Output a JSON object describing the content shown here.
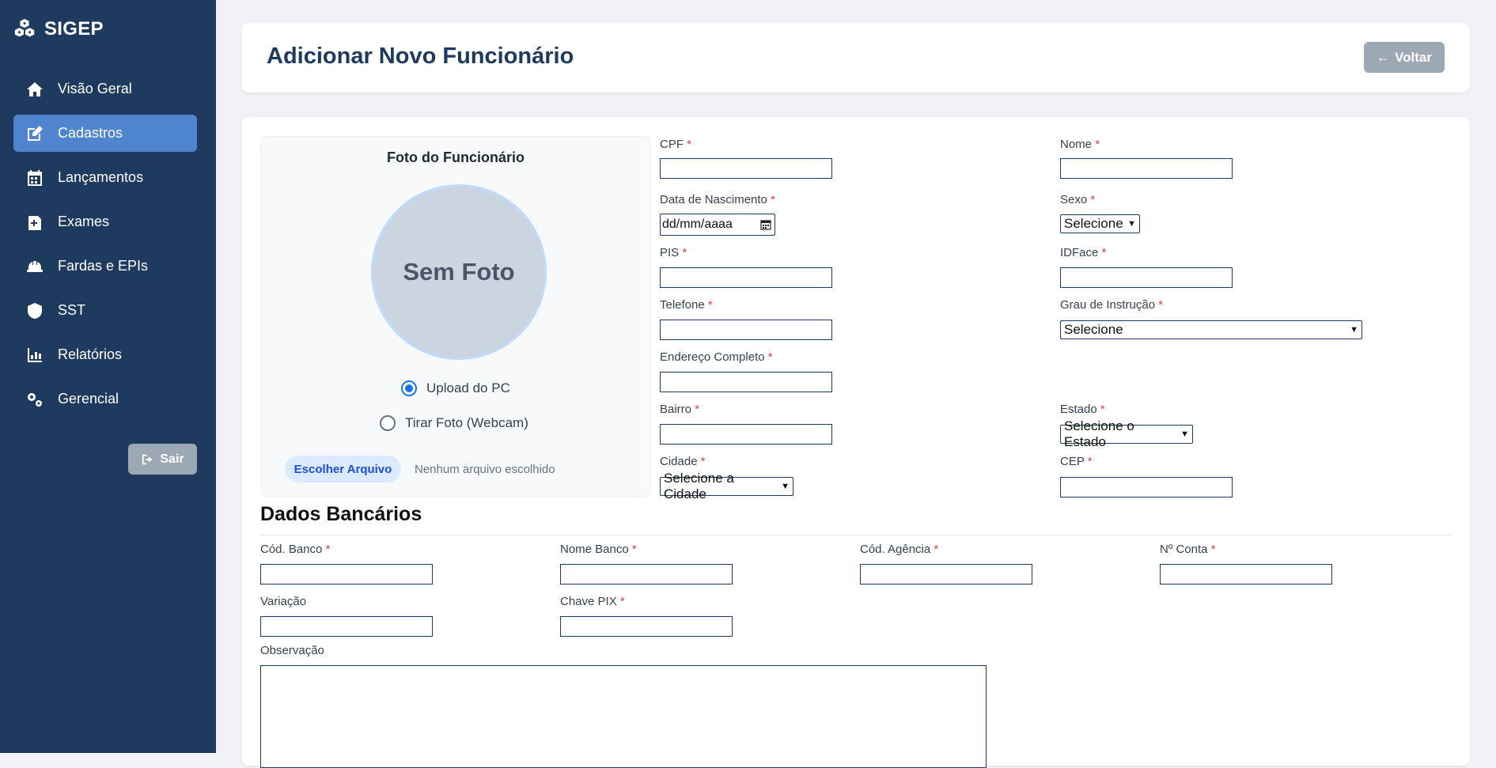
{
  "brand": {
    "name": "SIGEP"
  },
  "sidebar": {
    "items": [
      {
        "label": "Visão Geral",
        "icon": "home-icon",
        "active": false
      },
      {
        "label": "Cadastros",
        "icon": "edit-icon",
        "active": true
      },
      {
        "label": "Lançamentos",
        "icon": "calendar-icon",
        "active": false
      },
      {
        "label": "Exames",
        "icon": "medical-file-icon",
        "active": false
      },
      {
        "label": "Fardas e EPIs",
        "icon": "hard-hat-icon",
        "active": false
      },
      {
        "label": "SST",
        "icon": "shield-icon",
        "active": false
      },
      {
        "label": "Relatórios",
        "icon": "chart-icon",
        "active": false
      },
      {
        "label": "Gerencial",
        "icon": "gears-icon",
        "active": false
      }
    ],
    "logout_label": "Sair"
  },
  "header": {
    "title": "Adicionar Novo Funcionário",
    "back_label": "Voltar"
  },
  "photo": {
    "title": "Foto do Funcionário",
    "placeholder": "Sem Foto",
    "option_upload": "Upload do PC",
    "option_webcam": "Tirar Foto (Webcam)",
    "selected": "Upload do PC",
    "file_button": "Escolher Arquivo",
    "file_status": "Nenhum arquivo escolhido"
  },
  "fields": {
    "cpf": {
      "label": "CPF",
      "value": ""
    },
    "nome": {
      "label": "Nome",
      "value": ""
    },
    "nascimento": {
      "label": "Data de Nascimento",
      "placeholder": "dd/mm/aaaa"
    },
    "sexo": {
      "label": "Sexo",
      "selected": "Selecione"
    },
    "pis": {
      "label": "PIS",
      "value": ""
    },
    "idface": {
      "label": "IDFace",
      "value": ""
    },
    "telefone": {
      "label": "Telefone",
      "value": ""
    },
    "grau": {
      "label": "Grau de Instrução",
      "selected": "Selecione"
    },
    "endereco": {
      "label": "Endereço Completo",
      "value": ""
    },
    "bairro": {
      "label": "Bairro",
      "value": ""
    },
    "estado": {
      "label": "Estado",
      "selected": "Selecione o Estado"
    },
    "cidade": {
      "label": "Cidade",
      "selected": "Selecione a Cidade"
    },
    "cep": {
      "label": "CEP",
      "value": ""
    }
  },
  "bank": {
    "title": "Dados Bancários",
    "cod_banco": "Cód. Banco",
    "nome_banco": "Nome Banco",
    "cod_agencia": "Cód. Agência",
    "num_conta": "Nº Conta",
    "variacao": "Variação",
    "chave_pix": "Chave PIX",
    "observacao": "Observação"
  },
  "required_marker": "*",
  "colors": {
    "sidebar": "#1f3a5f",
    "active": "#4f84cf",
    "required": "#e53e3e"
  }
}
